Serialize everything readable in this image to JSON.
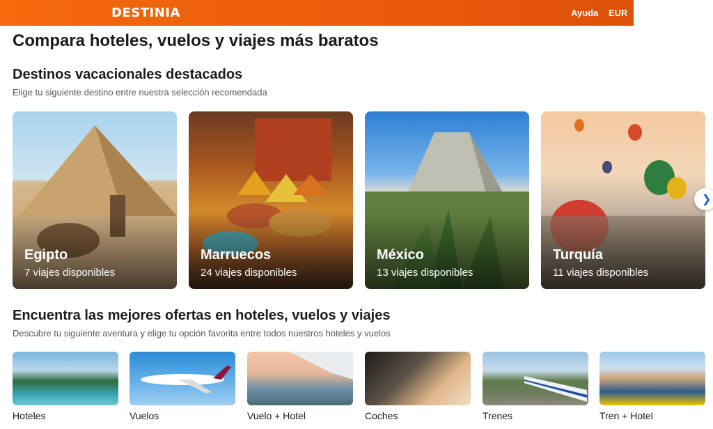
{
  "header": {
    "logo": "DESTINIA",
    "help": "Ayuda",
    "currency": "EUR"
  },
  "page_title": "Compara hoteles, vuelos y viajes más baratos",
  "featured": {
    "title": "Destinos vacacionales destacados",
    "subtitle": "Elige tu siguiente destino entre nuestra selección recomendada",
    "cards": [
      {
        "name": "Egipto",
        "count": "7 viajes disponibles"
      },
      {
        "name": "Marruecos",
        "count": "24 viajes disponibles"
      },
      {
        "name": "México",
        "count": "13 viajes disponibles"
      },
      {
        "name": "Turquía",
        "count": "11 viajes disponibles"
      }
    ],
    "next_icon": "chevron-right-icon"
  },
  "offers": {
    "title": "Encuentra las mejores ofertas en hoteles, vuelos y viajes",
    "subtitle": "Descubre tu siguiente aventura y elige tu opción favorita entre todos nuestros hoteles y vuelos",
    "items": [
      {
        "label": "Hoteles"
      },
      {
        "label": "Vuelos"
      },
      {
        "label": "Vuelo + Hotel"
      },
      {
        "label": "Coches"
      },
      {
        "label": "Trenes"
      },
      {
        "label": "Tren + Hotel"
      }
    ]
  },
  "colors": {
    "brand": "#e8590c",
    "accent_link": "#1a5bd6"
  }
}
